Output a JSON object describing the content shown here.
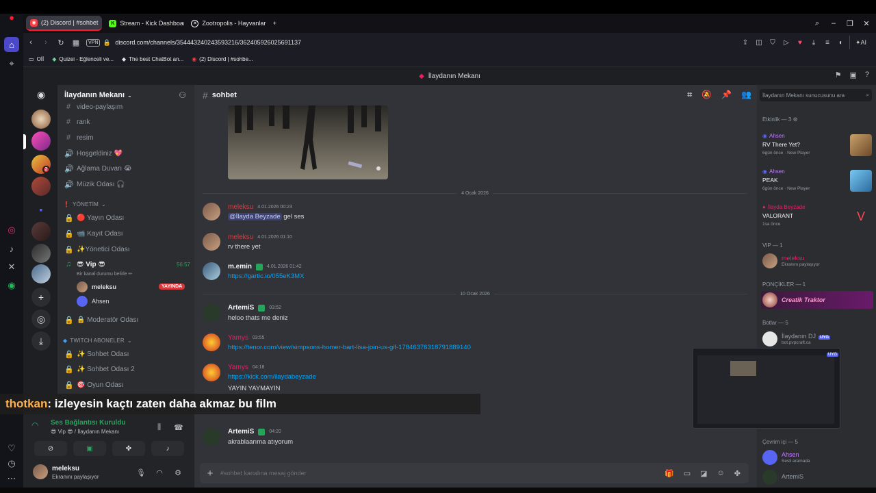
{
  "browser": {
    "tabs": [
      {
        "label": "(2) Discord | #sohbet",
        "active": true,
        "icon": "discord-icon",
        "color": "#f23f43"
      },
      {
        "label": "Stream - Kick Dashboard",
        "active": false,
        "icon": "kick-icon",
        "color": "#53fc18"
      },
      {
        "label": "Zootropolis - Hayvanlar Şe",
        "active": false,
        "icon": "film-icon",
        "color": "#ffffff"
      }
    ],
    "url": "discord.com/channels/354443240243593216/362405926025691137",
    "vpn": "VPN",
    "ai_label": "AI",
    "bookmarks": [
      "Oİİ",
      "Quizei - Eğlenceli ve...",
      "The best ChatBot an...",
      "(2) Discord | #sohbe..."
    ]
  },
  "discord": {
    "title": "İlaydanın Mekanı",
    "server_name": "İlaydanın Mekanı",
    "channels_top": [
      {
        "name": "video-paylaşım",
        "icon": "#"
      },
      {
        "name": "rank",
        "icon": "#"
      },
      {
        "name": "resim",
        "icon": "#"
      },
      {
        "name": "Hoşgeldiniz 💖",
        "icon": "🔊"
      },
      {
        "name": "Ağlama Duvarı 😭",
        "icon": "🔊"
      },
      {
        "name": "Müzik Odası 🎧",
        "icon": "🔊"
      }
    ],
    "cat_management": "YÖNETİM",
    "channels_mgmt": [
      {
        "name": "🔴 Yayın Odası"
      },
      {
        "name": "📹 Kayıt Odası"
      },
      {
        "name": "✨Yönetici Odası"
      }
    ],
    "vip_channel": "😎 Vip 😎",
    "vip_timer": "56:57",
    "vip_status": "Bir kanal durumu belirle ✏",
    "voice_users": [
      {
        "name": "meleksu",
        "live": "YAYINDA"
      },
      {
        "name": "Ahsen"
      }
    ],
    "mod_channel": "🔒 Moderatör Odası",
    "cat_twitch": "TWITCH ABONELER",
    "channels_twitch": [
      {
        "name": "✨ Sohbet Odası"
      },
      {
        "name": "✨ Sohbet Odası 2"
      },
      {
        "name": "🎯 Oyun Odası"
      }
    ],
    "voice_panel": {
      "status": "Ses Bağlantısı Kuruldu",
      "channel": "😎 Vip 😎 / İlaydanın Mekanı"
    },
    "user": {
      "name": "meleksu",
      "status": "Ekranını paylaşıyor"
    },
    "channel_name": "sohbet",
    "messages": [
      {
        "date": "4 Ocak 2026"
      },
      {
        "author": "meleksu",
        "ts": "4.01.2026 00:23",
        "mention": "@İlayda Beyzade",
        "text": "gel ses",
        "color": "#d83c3e"
      },
      {
        "author": "meleksu",
        "ts": "4.01.2026 01:10",
        "text": "rv there yet",
        "color": "#d83c3e"
      },
      {
        "author": "m.emin",
        "ts": "4.01.2026 01:42",
        "link": "https://gartic.io/055eK3MX",
        "color": "#f2f3f5"
      },
      {
        "date": "10 Ocak 2026"
      },
      {
        "author": "ArtemiS",
        "ts": "03:52",
        "text": "heloo thats me deniz",
        "color": "#f2f3f5"
      },
      {
        "author": "Yamys",
        "ts": "03:55",
        "link": "https://tenor.com/view/simpsons-homer-bart-lisa-join-us-gif-17846376318791889140",
        "color": "#e91e63"
      },
      {
        "author": "Yamys",
        "ts": "04:18",
        "link": "https://kick.com/ilaydabeyzade",
        "text": "YAYIN YAYMAYIN",
        "color": "#e91e63"
      },
      {
        "author": "ArtemiS",
        "ts": "04:20",
        "text": "akrablaarıma atıyorum",
        "color": "#f2f3f5"
      }
    ],
    "composer_placeholder": "#sohbet kanalına mesaj gönder",
    "member_search": "İlaydanın Mekanı sunucusunu ara",
    "activity_header": "Etkinlik — 3 ⚙",
    "activities": [
      {
        "user": "Ahsen",
        "game": "RV There Yet?",
        "meta": "6gün önce · New Player"
      },
      {
        "user": "Ahsen",
        "game": "PEAK",
        "meta": "6gün önce · New Player"
      },
      {
        "user": "İlayda Beyzade",
        "game": "VALORANT",
        "meta": "1sa önce"
      }
    ],
    "vip_header": "VIP — 1",
    "vip_member": {
      "name": "meleksu",
      "sub": "Ekranını paylaşıyor"
    },
    "ponc_header": "PONÇİKLER — 1",
    "ponc_member": "Creatik Traktor",
    "bots_header": "Botlar — 5",
    "bot_member": {
      "name": "İlaydanın DJ",
      "tag": "UYG",
      "sub": "bot.pvpcraft.ca"
    },
    "online_header": "Çevrim içi — 5",
    "online_members": [
      {
        "name": "Ahsen",
        "sub": "Sesli aramada"
      },
      {
        "name": "ArtemiS",
        "sub": ""
      }
    ]
  },
  "caption": {
    "who": "thotkan",
    "text": ": izleyesin kaçtı zaten daha akmaz bu film"
  },
  "stream_thumb_tag": "UYG",
  "colors": {
    "accent": "#5865f2",
    "green": "#23a55a",
    "red": "#da373c",
    "link": "#00a8fc"
  }
}
